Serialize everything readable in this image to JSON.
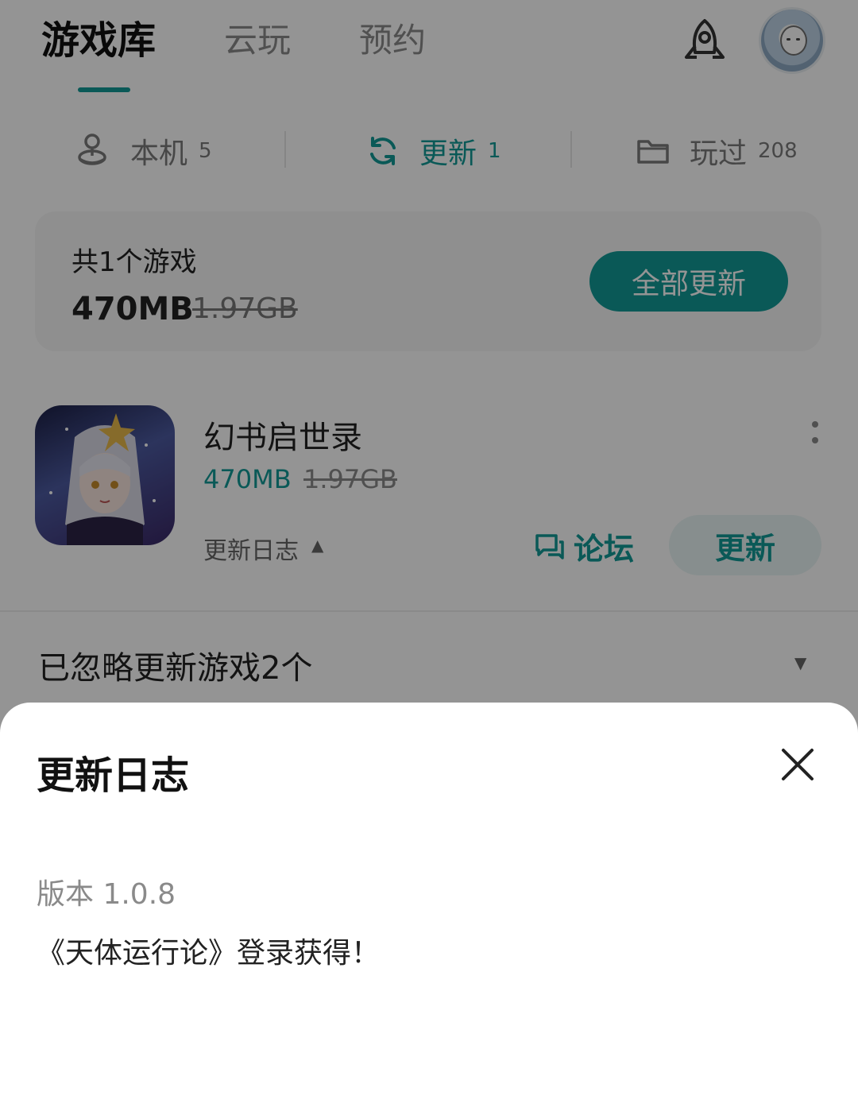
{
  "header": {
    "tabs": [
      {
        "label": "游戏库",
        "active": true
      },
      {
        "label": "云玩",
        "active": false
      },
      {
        "label": "预约",
        "active": false
      }
    ],
    "accent_color": "#129a96",
    "icons": [
      "rocket-icon",
      "avatar"
    ]
  },
  "subtabs": [
    {
      "label": "本机",
      "count": "5",
      "icon": "joystick-icon",
      "active": false
    },
    {
      "label": "更新",
      "count": "1",
      "icon": "refresh-icon",
      "active": true
    },
    {
      "label": "玩过",
      "count": "208",
      "icon": "folder-icon",
      "active": false
    }
  ],
  "summary": {
    "title": "共1个游戏",
    "size": "470MB",
    "old_size": "1.97GB",
    "update_all_label": "全部更新"
  },
  "game": {
    "name": "幻书启世录",
    "size": "470MB",
    "old_size": "1.97GB",
    "changelog_label": "更新日志",
    "changelog_caret": "▲",
    "forum_label": "论坛",
    "update_label": "更新"
  },
  "ignored": {
    "label": "已忽略更新游戏2个",
    "caret": "▼"
  },
  "sheet": {
    "title": "更新日志",
    "version": "版本 1.0.8",
    "note": "《天体运行论》登录获得！"
  }
}
